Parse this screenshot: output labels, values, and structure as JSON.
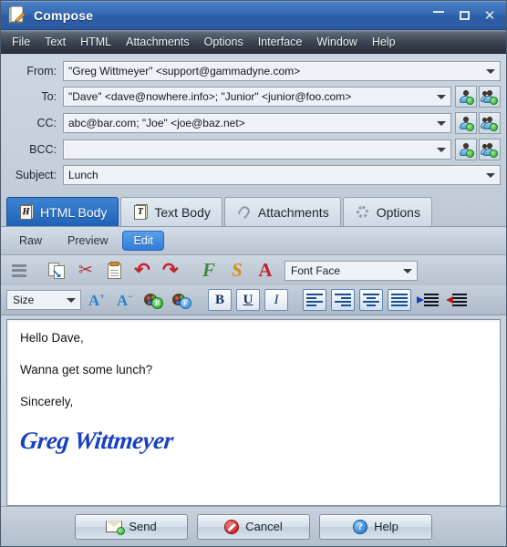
{
  "window": {
    "title": "Compose",
    "app_icon": "compose-document-pencil-icon",
    "controls": {
      "minimize": "minimize-button",
      "maximize": "maximize-button",
      "close": "close-button"
    }
  },
  "menubar": {
    "items": [
      {
        "label": "File"
      },
      {
        "label": "Text"
      },
      {
        "label": "HTML"
      },
      {
        "label": "Attachments"
      },
      {
        "label": "Options"
      },
      {
        "label": "Interface"
      },
      {
        "label": "Window"
      },
      {
        "label": "Help"
      }
    ]
  },
  "fields": [
    {
      "label": "From:",
      "value": "\"Greg Wittmeyer\" <support@gammadyne.com>",
      "has_contact_buttons": false
    },
    {
      "label": "To:",
      "value": "\"Dave\" <dave@nowhere.info>; \"Junior\" <junior@foo.com>",
      "has_contact_buttons": true
    },
    {
      "label": "CC:",
      "value": "abc@bar.com; \"Joe\" <joe@baz.net>",
      "has_contact_buttons": true
    },
    {
      "label": "BCC:",
      "value": "",
      "has_contact_buttons": true
    },
    {
      "label": "Subject:",
      "value": "Lunch",
      "has_contact_buttons": false
    }
  ],
  "contact_buttons": {
    "single": "add-contact-icon",
    "group": "add-contact-group-icon"
  },
  "tabs": [
    {
      "label": "HTML Body",
      "icon": "html-document-icon",
      "active": true
    },
    {
      "label": "Text Body",
      "icon": "text-document-icon",
      "active": false
    },
    {
      "label": "Attachments",
      "icon": "paperclip-icon",
      "active": false
    },
    {
      "label": "Options",
      "icon": "gear-icon",
      "active": false
    }
  ],
  "subtabs": [
    {
      "label": "Raw",
      "active": false
    },
    {
      "label": "Preview",
      "active": false
    },
    {
      "label": "Edit",
      "active": true
    }
  ],
  "toolbar_row1": [
    {
      "name": "menu-hamburger-button",
      "icon": "hamburger-menu-icon"
    },
    {
      "name": "copy-button",
      "icon": "copy-icon"
    },
    {
      "name": "cut-button",
      "icon": "scissors-icon"
    },
    {
      "name": "paste-button",
      "icon": "clipboard-icon"
    },
    {
      "name": "undo-button",
      "icon": "undo-arrow-icon"
    },
    {
      "name": "redo-button",
      "icon": "redo-arrow-icon"
    },
    {
      "name": "insert-field-button",
      "icon": "fancy-f-icon"
    },
    {
      "name": "insert-symbol-button",
      "icon": "fancy-s-icon"
    },
    {
      "name": "insert-letter-button",
      "icon": "fancy-a-icon"
    }
  ],
  "font_face": {
    "label": "Font Face",
    "placeholder": "Font Face"
  },
  "font_size": {
    "label": "Size",
    "placeholder": "Size"
  },
  "toolbar_row2": [
    {
      "name": "increase-font-size-button",
      "icon": "font-increase-icon",
      "glyph": "A",
      "sup": "+"
    },
    {
      "name": "decrease-font-size-button",
      "icon": "font-decrease-icon",
      "glyph": "A",
      "sup": "−"
    },
    {
      "name": "background-color-button",
      "icon": "palette-background-icon",
      "badge": "B"
    },
    {
      "name": "foreground-color-button",
      "icon": "palette-foreground-icon",
      "badge": "F"
    },
    {
      "name": "bold-button",
      "icon": "bold-icon",
      "glyph": "B"
    },
    {
      "name": "underline-button",
      "icon": "underline-icon",
      "glyph": "U"
    },
    {
      "name": "italic-button",
      "icon": "italic-icon",
      "glyph": "I"
    },
    {
      "name": "align-left-button",
      "icon": "align-left-icon"
    },
    {
      "name": "align-right-button",
      "icon": "align-right-icon"
    },
    {
      "name": "align-center-button",
      "icon": "align-center-icon"
    },
    {
      "name": "align-justify-button",
      "icon": "align-justify-icon"
    },
    {
      "name": "indent-increase-button",
      "icon": "indent-increase-icon"
    },
    {
      "name": "indent-decrease-button",
      "icon": "indent-decrease-icon"
    }
  ],
  "body": {
    "lines": [
      "Hello Dave,",
      "Wanna get some lunch?",
      "Sincerely,"
    ],
    "signature": "Greg Wittmeyer",
    "signature_color": "#1a3fc0"
  },
  "footer": {
    "send": {
      "label": "Send",
      "icon": "envelope-send-icon"
    },
    "cancel": {
      "label": "Cancel",
      "icon": "cancel-circle-icon"
    },
    "help": {
      "label": "Help",
      "icon": "help-circle-icon",
      "glyph": "?"
    }
  },
  "colors": {
    "titlebar": "#2d5fa8",
    "menubar": "#3b4250",
    "accent": "#1f62b8",
    "chrome": "#c3cdd8"
  }
}
